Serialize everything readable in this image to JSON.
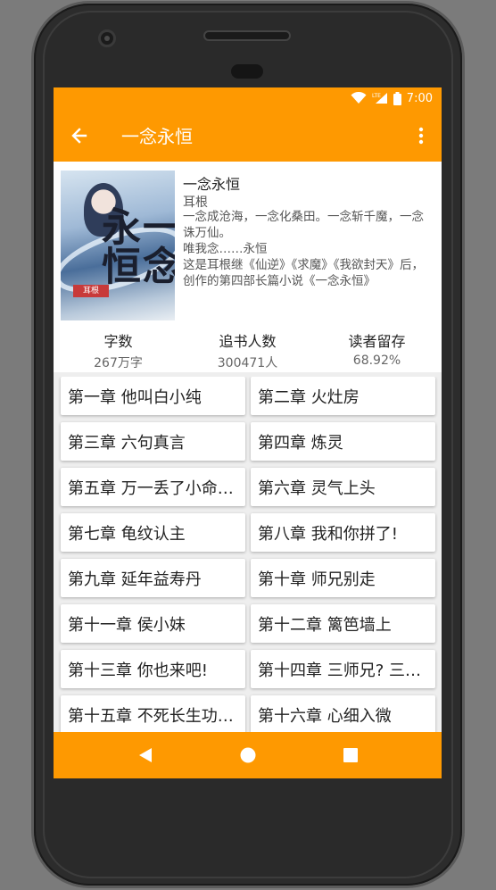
{
  "status_bar": {
    "time": "7:00",
    "network": "LTE"
  },
  "app_bar": {
    "title": "一念永恒"
  },
  "book": {
    "title": "一念永恒",
    "author": "耳根",
    "description": "一念成沧海，一念化桑田。一念斩千魔，一念诛万仙。\n    唯我念……永恒\n    这是耳根继《仙逆》《求魔》《我欲封天》后，创作的第四部长篇小说《一念永恒》",
    "cover_alt_text": "一念永恒",
    "cover_author_text": "耳根"
  },
  "stats": [
    {
      "label": "字数",
      "value": "267万字"
    },
    {
      "label": "追书人数",
      "value": "300471人"
    },
    {
      "label": "读者留存",
      "value": "68.92%"
    }
  ],
  "chapters": [
    "第一章 他叫白小纯",
    "第二章 火灶房",
    "第三章 六句真言",
    "第四章 炼灵",
    "第五章 万一丢了小命…",
    "第六章 灵气上头",
    "第七章 龟纹认主",
    "第八章 我和你拼了!",
    "第九章 延年益寿丹",
    "第十章 师兄别走",
    "第十一章 侯小妹",
    "第十二章 篱笆墙上",
    "第十三章 你也来吧!",
    "第十四章 三师兄? 三…",
    "第十五章 不死长生功…",
    "第十六章 心细入微"
  ],
  "colors": {
    "accent": "#fe9901",
    "card": "#ffffff",
    "background": "#eeeeee"
  },
  "icons": {
    "back": "arrow-left-icon",
    "more": "more-vert-icon",
    "wifi": "wifi-icon",
    "signal": "signal-icon",
    "battery": "battery-icon",
    "nav_back": "nav-back-icon",
    "nav_home": "nav-home-icon",
    "nav_recents": "nav-recents-icon"
  }
}
